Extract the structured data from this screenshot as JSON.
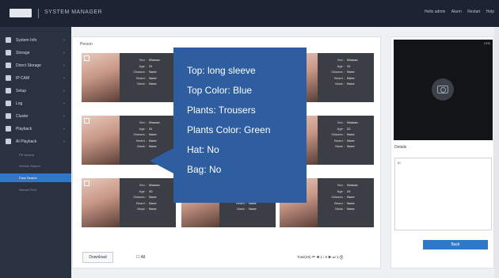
{
  "header": {
    "logo": "EDVS",
    "title": "SYSTEM MANAGER",
    "links": [
      "Hello admin",
      "Alarm",
      "Restart",
      "Help"
    ]
  },
  "sidebar": {
    "items": [
      {
        "label": "System Info",
        "icon": "gear-icon"
      },
      {
        "label": "Storage",
        "icon": "storage-icon"
      },
      {
        "label": "Direct Storage",
        "icon": "upload-icon"
      },
      {
        "label": "IP CAM",
        "icon": "camera-icon"
      },
      {
        "label": "Setup",
        "icon": "settings-icon"
      },
      {
        "label": "Log",
        "icon": "document-icon"
      },
      {
        "label": "Cluster",
        "icon": "warning-icon"
      },
      {
        "label": "Playback",
        "icon": "film-icon"
      },
      {
        "label": "AI Playback",
        "icon": "ai-icon"
      }
    ],
    "subitems": [
      {
        "label": "FR Search",
        "active": false
      },
      {
        "label": "Vehicle Search",
        "active": false
      },
      {
        "label": "Face Search",
        "active": true
      },
      {
        "label": "Human Find",
        "active": false
      }
    ]
  },
  "main": {
    "title": "Person",
    "cards": [
      {
        "values": {
          "sex": "Woman",
          "age": "31",
          "glasses": "None",
          "beard": "None",
          "mask": "None"
        }
      },
      {
        "values": {
          "sex": "Woman",
          "age": "31",
          "glasses": "None",
          "beard": "None",
          "mask": "None"
        }
      },
      {
        "values": {
          "sex": "Woman",
          "age": "31",
          "glasses": "None",
          "beard": "None",
          "mask": "None"
        }
      },
      {
        "values": {
          "sex": "Woman",
          "age": "31",
          "glasses": "None",
          "beard": "None",
          "mask": "None"
        }
      },
      {
        "values": {
          "sex": "Woman",
          "age": "31",
          "glasses": "None",
          "beard": "None",
          "mask": "None"
        }
      },
      {
        "values": {
          "sex": "Woman",
          "age": "22",
          "glasses": "None",
          "beard": "None",
          "mask": "None"
        }
      },
      {
        "values": {
          "sex": "Woman",
          "age": "30",
          "glasses": "None",
          "beard": "None",
          "mask": "None"
        }
      },
      {
        "values": {
          "sex": "Woman",
          "age": "31",
          "glasses": "None",
          "beard": "None",
          "mask": "None"
        }
      },
      {
        "values": {
          "sex": "Woman",
          "age": "24",
          "glasses": "None",
          "beard": "None",
          "mask": "None"
        }
      }
    ],
    "field_labels": {
      "sex": "Sex :",
      "age": "Age :",
      "glasses": "Glasses :",
      "beard": "Beard :",
      "mask": "Mask :"
    },
    "download_label": "Download",
    "all_label": "All",
    "pager_text": "Total(49) ⏮ ◀ 1 / 6 ▶ ⏭ 1 Ⓖ"
  },
  "right_panel": {
    "video_label": "CH1",
    "details_label": "Details",
    "details_value": "ID",
    "back_label": "Back"
  },
  "overlay": {
    "lines": [
      "Top: long sleeve",
      "Top Color: Blue",
      "Plants: Trousers",
      "Plants Color: Green",
      "Hat: No",
      "Bag: No"
    ]
  },
  "colors": {
    "accent": "#2f78c8",
    "overlay": "#2e5da0",
    "topbar": "#1c2433",
    "sidebar": "#2a3140"
  }
}
